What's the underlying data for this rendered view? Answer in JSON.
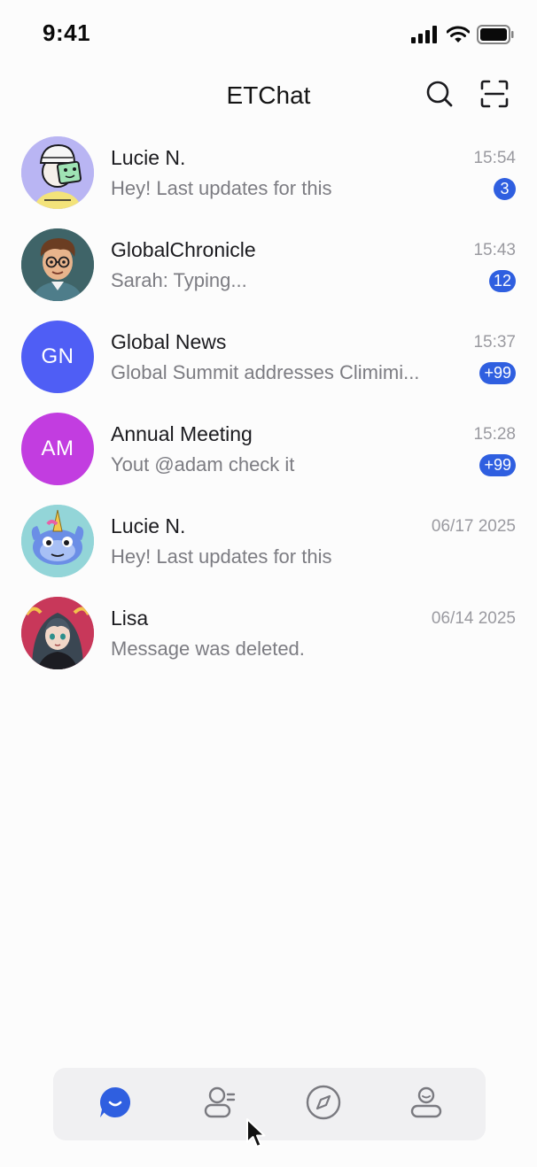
{
  "status_bar": {
    "time": "9:41"
  },
  "header": {
    "title": "ETChat",
    "search_icon": "search-icon",
    "scan_icon": "scan-icon"
  },
  "chats": [
    {
      "name": "Lucie N.",
      "preview": "Hey! Last updates for this",
      "time": "15:54",
      "badge": "3",
      "avatar": "illustrated-avatar"
    },
    {
      "name": "GlobalChronicle",
      "preview": "Sarah: Typing...",
      "time": "15:43",
      "badge": "12",
      "avatar": "cartoon-boy-avatar"
    },
    {
      "name": "Global News",
      "preview": "Global Summit addresses Climimi...",
      "time": "15:37",
      "badge": "+99",
      "avatar_initials": "GN",
      "avatar_color": "#4f5ef5"
    },
    {
      "name": "Annual Meeting",
      "preview": "Yout @adam check it",
      "time": "15:28",
      "badge": "+99",
      "avatar_initials": "AM",
      "avatar_color": "#c23de0"
    },
    {
      "name": "Lucie N.",
      "preview": "Hey! Last updates for this",
      "time": "06/17 2025",
      "avatar": "unicorn-avatar"
    },
    {
      "name": "Lisa",
      "preview": "Message was deleted.",
      "time": "06/14 2025",
      "avatar": "anime-girl-avatar"
    }
  ],
  "tab_bar": {
    "tabs": [
      {
        "name": "chats",
        "icon": "chat-bubble-icon",
        "active": true
      },
      {
        "name": "contacts",
        "icon": "contacts-icon",
        "active": false
      },
      {
        "name": "discover",
        "icon": "compass-icon",
        "active": false
      },
      {
        "name": "me",
        "icon": "profile-icon",
        "active": false
      }
    ]
  },
  "colors": {
    "accent": "#2f5fe0",
    "badge": "#2f5fe0",
    "inactive_icon": "#7a7a80"
  }
}
